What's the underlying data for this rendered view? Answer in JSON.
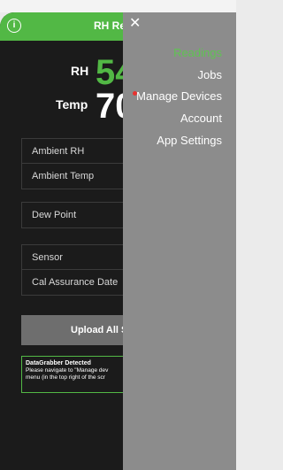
{
  "app": {
    "title": "RH Re",
    "info_icon": "info-icon"
  },
  "readings": {
    "rh_label": "RH",
    "rh_value": "54",
    "temp_label": "Temp",
    "temp_value": "70"
  },
  "rows_group1": [
    "Ambient RH",
    "Ambient Temp"
  ],
  "rows_group2": [
    "Dew Point"
  ],
  "rows_group3": [
    "Sensor",
    "Cal Assurance Date"
  ],
  "upload_button": "Upload All S",
  "notice": {
    "title": "DataGrabber Detected",
    "line1": "Please navigate to \"Manage dev",
    "line2": "menu (in the top right of the scr"
  },
  "menu": {
    "close_icon": "close-icon",
    "items": [
      {
        "label": "Readings",
        "active": true
      },
      {
        "label": "Jobs",
        "active": false
      },
      {
        "label": "Manage Devices",
        "active": false,
        "alert": true
      },
      {
        "label": "Account",
        "active": false
      },
      {
        "label": "App Settings",
        "active": false
      }
    ]
  },
  "colors": {
    "accent": "#52b845",
    "menu_bg": "#8c8c8c",
    "app_bg": "#1b1b1b",
    "alert": "#e8322f"
  }
}
